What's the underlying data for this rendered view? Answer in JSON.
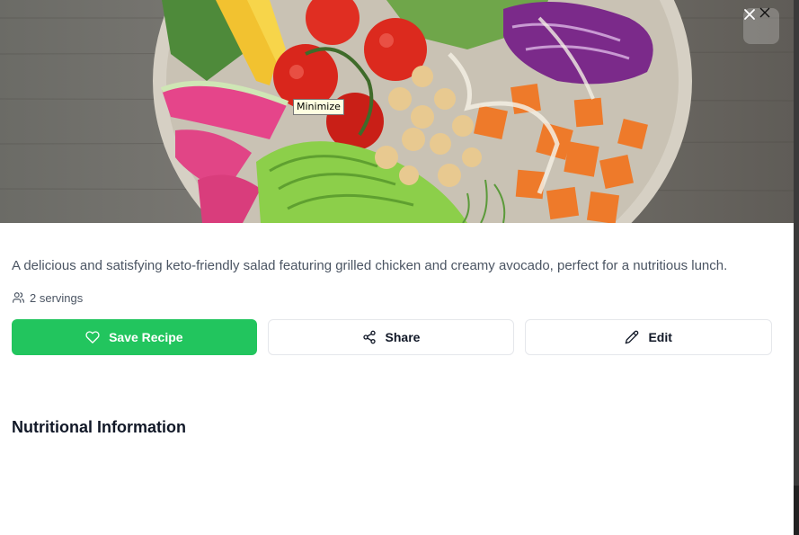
{
  "tooltip": {
    "text": "Minimize"
  },
  "recipe": {
    "description": "A delicious and satisfying keto-friendly salad featuring grilled chicken and creamy avocado, perfect for a nutritious lunch.",
    "servings_text": "2 servings"
  },
  "actions": {
    "save_label": "Save Recipe",
    "share_label": "Share",
    "edit_label": "Edit"
  },
  "sections": {
    "nutrition_title": "Nutritional Information"
  },
  "colors": {
    "primary": "#22c55e",
    "text_muted": "#4b5563",
    "text_dark": "#111827",
    "border": "#e5e7eb"
  },
  "icons": {
    "close": "close-icon",
    "servings": "users-icon",
    "save": "heart-icon",
    "share": "share-icon",
    "edit": "pencil-icon"
  }
}
